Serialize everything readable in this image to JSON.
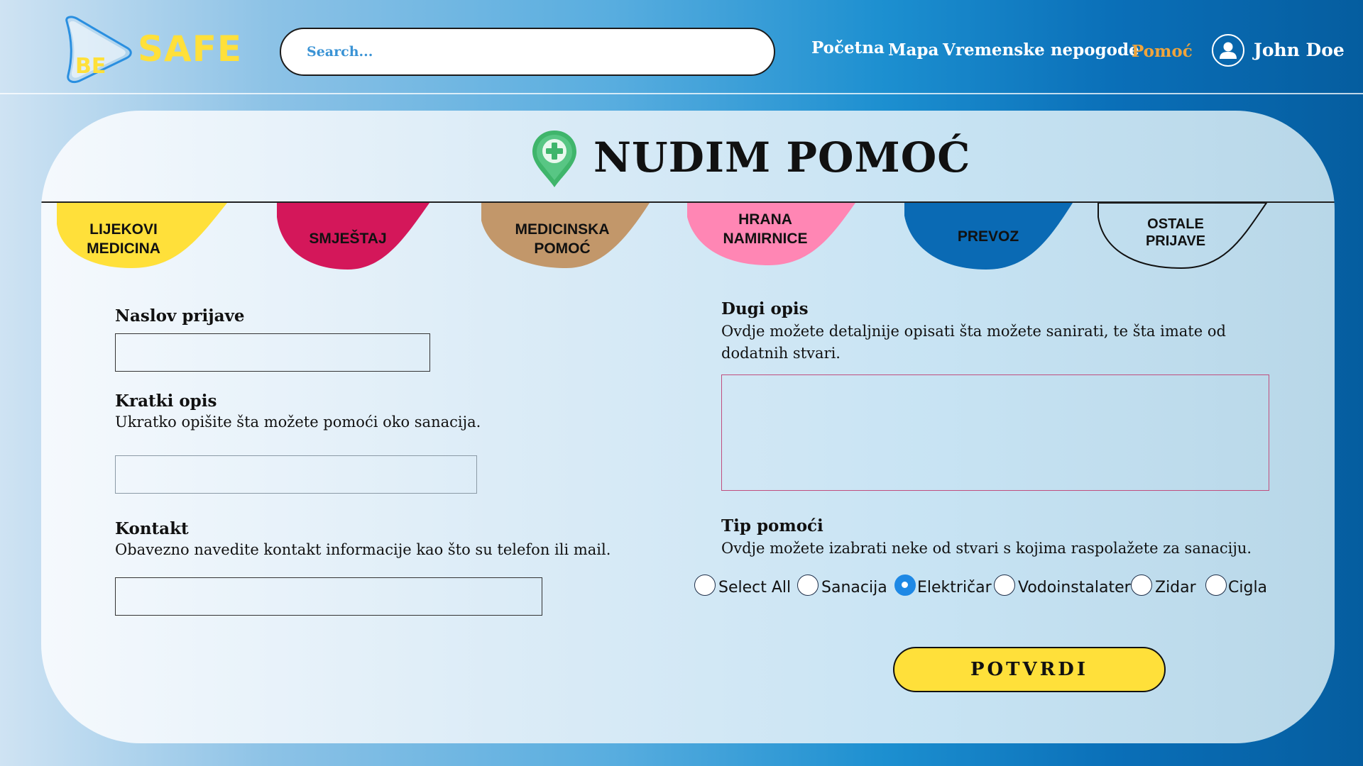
{
  "header": {
    "logo": {
      "prefix": "BE",
      "name": "SAFE"
    },
    "search": {
      "placeholder": "Search..."
    },
    "nav": [
      "Početna",
      "Mapa",
      "Vremenske nepogode",
      "Pomoć"
    ],
    "active_nav": "Pomoć",
    "user": {
      "name": "John Doe"
    }
  },
  "page": {
    "title": "NUDIM POMOĆ"
  },
  "categories": [
    {
      "label": "LIJEKOVI\nMEDICINA",
      "color": "#ffe03a"
    },
    {
      "label": "SMJEŠTAJ",
      "color": "#d4175a"
    },
    {
      "label": "MEDICINSKA\nPOMOĆ",
      "color": "#c2976a"
    },
    {
      "label": "HRANA\nNAMIRNICE",
      "color": "#ff86b4"
    },
    {
      "label": "PREVOZ",
      "color": "#0a6ab4"
    },
    {
      "label": "OSTALE\nPRIJAVE",
      "color": "none"
    }
  ],
  "form": {
    "naslov": {
      "label": "Naslov prijave",
      "value": ""
    },
    "kratki": {
      "label": "Kratki opis",
      "hint": "Ukratko opišite šta možete pomoći oko sanacija.",
      "value": ""
    },
    "kontakt": {
      "label": "Kontakt",
      "hint": "Obavezno navedite kontakt informacije kao što su telefon ili mail.",
      "value": ""
    },
    "dugi": {
      "label": "Dugi opis",
      "hint": "Ovdje možete detaljnije opisati šta možete sanirati, te šta imate od dodatnih stvari.",
      "value": ""
    },
    "tip": {
      "label": "Tip pomoći",
      "hint": "Ovdje možete izabrati neke od stvari s kojima raspolažete za sanaciju.",
      "options": [
        "Select All",
        "Sanacija",
        "Električar",
        "Vodoinstalater",
        "Zidar",
        "Cigla"
      ],
      "selected": "Električar"
    },
    "submit_label": "POTVRDI"
  },
  "colors": {
    "accent_yellow": "#ffe03a",
    "active_nav": "#f0a43b",
    "radio_selected": "#1e88e5"
  }
}
